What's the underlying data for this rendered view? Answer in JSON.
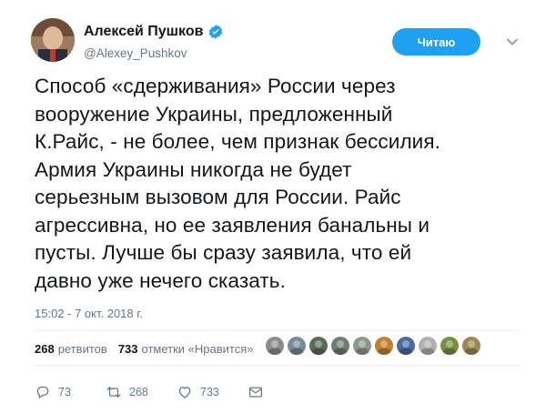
{
  "author": {
    "name": "Алексей Пушков",
    "handle": "@Alexey_Pushkov",
    "verified": true
  },
  "follow_button": {
    "label": "Читаю"
  },
  "tweet": {
    "lines": [
      "Способ «сдерживания» России через",
      "вооружение Украины, предложенный",
      "К.Райс, - не более, чем признак бессилия.",
      "Армия Украины никогда не будет",
      "серьезным вызовом для России. Райс",
      "агрессивна, но ее заявления банальны и",
      "пусты. Лучше бы сразу заявила, что ей",
      "давно уже нечего сказать."
    ],
    "timestamp": "15:02 - 7 окт. 2018 г."
  },
  "stats": {
    "retweets_count": "268",
    "retweets_label": "ретвитов",
    "likes_count": "733",
    "likes_label": "отметки «Нравится»",
    "liker_colors": [
      "#8c8c8c",
      "#7a8a96",
      "#5a6b5a",
      "#6f7f6f",
      "#8a9a8a",
      "#c08030",
      "#4a6aa0",
      "#b0b0b0",
      "#7a9040",
      "#9a8a50"
    ]
  },
  "actions": {
    "reply_count": "73",
    "retweet_count": "268",
    "like_count": "733"
  },
  "colors": {
    "accent": "#1da1f2",
    "secondary_text": "#657786",
    "divider": "#e6ecf0"
  }
}
